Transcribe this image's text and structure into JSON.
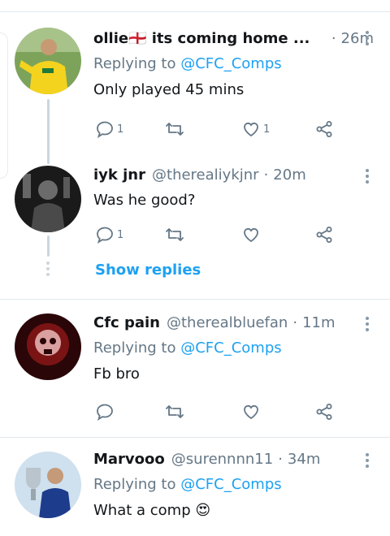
{
  "colors": {
    "link": "#1da1f2",
    "muted": "#657786",
    "text": "#14171a",
    "divider": "#e1e8ed"
  },
  "tweets": [
    {
      "name": "ollie🏴󠁧󠁢󠁥󠁮󠁧󠁿 its coming home ...",
      "handle": "",
      "time": "26m",
      "replying_prefix": "Replying to",
      "replying_to": "@CFC_Comps",
      "text": "Only played 45 mins",
      "reply_count": "1",
      "retweet_count": "",
      "like_count": "1",
      "avatar_icon": "avatar-player-yellow-icon"
    },
    {
      "name": "iyk jnr",
      "handle": "@therealiykjnr",
      "time": "20m",
      "replying_prefix": "",
      "replying_to": "",
      "text": "Was he good?",
      "reply_count": "1",
      "retweet_count": "",
      "like_count": "",
      "avatar_icon": "avatar-dark-figure-icon"
    },
    {
      "name": "Cfc pain",
      "handle": "@therealbluefan",
      "time": "11m",
      "replying_prefix": "Replying to",
      "replying_to": "@CFC_Comps",
      "text": "Fb bro",
      "reply_count": "",
      "retweet_count": "",
      "like_count": "",
      "avatar_icon": "avatar-red-skull-icon"
    },
    {
      "name": "Marvooo",
      "handle": "@surennnn11",
      "time": "34m",
      "replying_prefix": "Replying to",
      "replying_to": "@CFC_Comps",
      "text": "What a comp 😍",
      "reply_count": "",
      "retweet_count": "",
      "like_count": "",
      "avatar_icon": "avatar-trophy-player-icon"
    }
  ],
  "show_replies_label": "Show replies",
  "separator_dot": "·"
}
